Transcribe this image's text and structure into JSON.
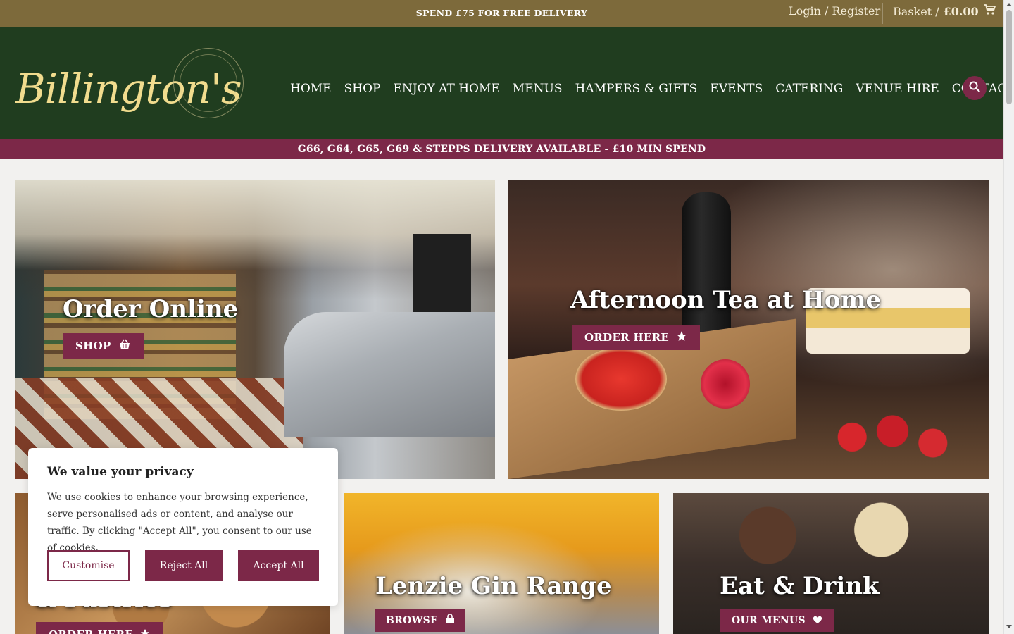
{
  "topbar": {
    "promo": "SPEND £75 FOR FREE DELIVERY",
    "login": "Login / Register",
    "basket_label": "Basket /",
    "basket_total": "£0.00"
  },
  "header": {
    "logo": "Billington's",
    "nav": [
      "HOME",
      "SHOP",
      "ENJOY AT HOME",
      "MENUS",
      "HAMPERS & GIFTS",
      "EVENTS",
      "CATERING",
      "VENUE HIRE",
      "CONTACT"
    ]
  },
  "delivery_bar": "G66, G64, G65, G69 & STEPPS DELIVERY AVAILABLE - £10 MIN SPEND",
  "tiles": [
    {
      "title": "Order Online",
      "button": "SHOP",
      "icon": "basket-icon"
    },
    {
      "title": "Afternoon Tea at Home",
      "button": "ORDER HERE",
      "icon": "star-icon"
    },
    {
      "title": "& Pastries",
      "button": "ORDER HERE",
      "icon": "star-icon"
    },
    {
      "title": "Lenzie Gin Range",
      "button": "BROWSE",
      "icon": "bag-icon"
    },
    {
      "title": "Eat & Drink",
      "button": "OUR MENUS",
      "icon": "heart-icon"
    }
  ],
  "cookie": {
    "title": "We value your privacy",
    "body": "We use cookies to enhance your browsing experience, serve personalised ads or content, and analyse our traffic. By clicking \"Accept All\", you consent to our use of cookies.",
    "customise": "Customise",
    "reject": "Reject All",
    "accept": "Accept All"
  },
  "colors": {
    "topbar": "#7d6a3b",
    "header": "#203d1f",
    "accent": "#7c2848",
    "logo": "#f1dc8e"
  }
}
